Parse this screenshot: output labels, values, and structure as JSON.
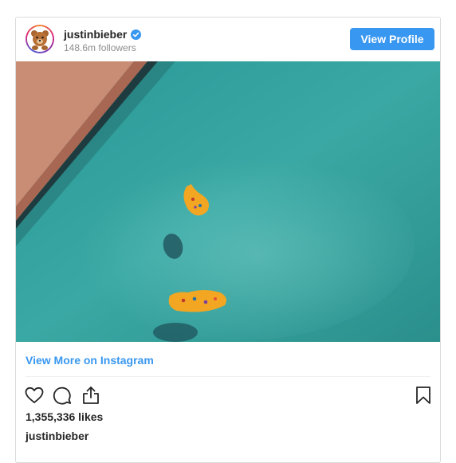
{
  "post": {
    "username": "justinbieber",
    "verified": true,
    "followers": "148.6m followers",
    "view_profile_label": "View Profile",
    "view_more_label": "View More on Instagram",
    "likes": "1,355,336 likes",
    "caption_username": "justinbieber"
  },
  "icons": {
    "like": "heart-icon",
    "comment": "comment-icon",
    "share": "share-icon",
    "save": "bookmark-icon",
    "verified": "verified-badge-icon"
  },
  "colors": {
    "accent": "#3897f0",
    "border": "#dbdbdb",
    "muted_text": "#8e8e8e",
    "pool_water": "#2f9a98",
    "croc_orange": "#f2a622"
  }
}
